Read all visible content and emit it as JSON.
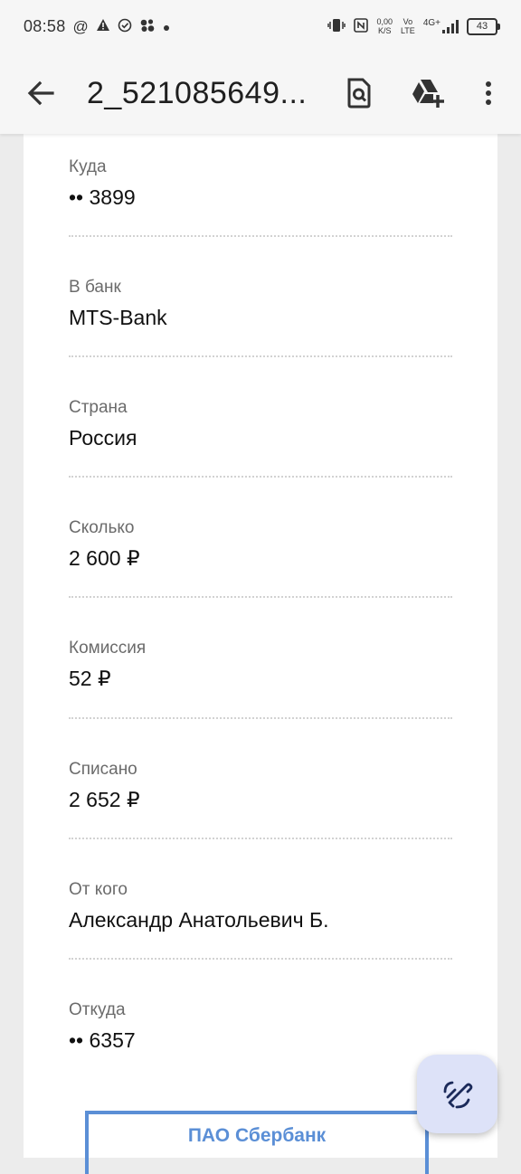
{
  "status_bar": {
    "time": "08:58",
    "icons": [
      "at-icon",
      "warning-icon",
      "check-circle-icon",
      "cluster-icon",
      "dot-icon"
    ],
    "net_speed_value": "0,00",
    "net_speed_unit": "K/S",
    "volte_top": "Vo",
    "volte_bottom": "LTE",
    "network": "4G+",
    "battery": "43"
  },
  "app_bar": {
    "title": "2_521085649..."
  },
  "fields": [
    {
      "label": "Куда",
      "value": "•• 3899"
    },
    {
      "label": "В банк",
      "value": "MTS-Bank"
    },
    {
      "label": "Страна",
      "value": "Россия"
    },
    {
      "label": "Сколько",
      "value": "2 600 ₽"
    },
    {
      "label": "Комиссия",
      "value": "52 ₽"
    },
    {
      "label": "Списано",
      "value": "2 652 ₽"
    },
    {
      "label": "От кого",
      "value": "Александр Анатольевич Б."
    },
    {
      "label": "Откуда",
      "value": "•• 6357"
    }
  ],
  "bank_stamp": "ПАО Сбербанк",
  "colors": {
    "accent_blue": "#5b8fd6",
    "fab_bg": "#dde2f8",
    "fab_icon": "#1b2a5a"
  }
}
